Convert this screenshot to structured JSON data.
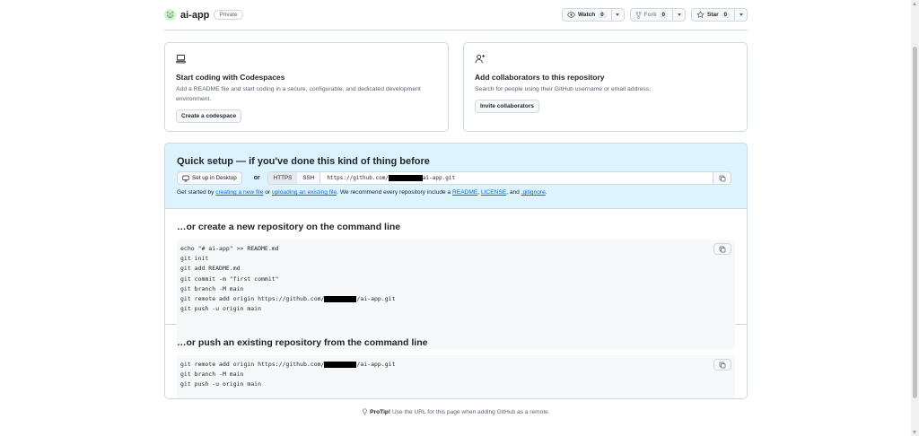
{
  "header": {
    "repo_name": "ai-app",
    "visibility": "Private",
    "watch": {
      "label": "Watch",
      "count": "0"
    },
    "fork": {
      "label": "Fork",
      "count": "0"
    },
    "star": {
      "label": "Star",
      "count": "0"
    }
  },
  "codespaces_card": {
    "title": "Start coding with Codespaces",
    "desc": "Add a README file and start coding in a secure, configurable, and dedicated development environment.",
    "button": "Create a codespace"
  },
  "collab_card": {
    "title": "Add collaborators to this repository",
    "desc": "Search for people using their GitHub username or email address.",
    "button": "Invite collaborators"
  },
  "quick_setup": {
    "title": "Quick setup — if you've done this kind of thing before",
    "desktop_button": "Set up in Desktop",
    "or": "or",
    "https": "HTTPS",
    "ssh": "SSH",
    "url_prefix": "https://github.com/",
    "url_suffix": "ai-app.git",
    "hint": {
      "p1": "Get started by ",
      "link1": "creating a new file",
      "p2": " or ",
      "link2": "uploading an existing file",
      "p3": ". We recommend every repository include a ",
      "link3": "README",
      "p4": ", ",
      "link4": "LICENSE",
      "p5": ", and ",
      "link5": ".gitignore",
      "p6": "."
    }
  },
  "new_repo": {
    "title": "…or create a new repository on the command line",
    "lines": [
      "echo \"# ai-app\" >> README.md",
      "git init",
      "git add README.md",
      "git commit -m \"first commit\"",
      "git branch -M main",
      "git remote add origin https://github.com/",
      "git push -u origin main"
    ],
    "remote_suffix": "/ai-app.git"
  },
  "push_repo": {
    "title": "…or push an existing repository from the command line",
    "remote_prefix": "git remote add origin https://github.com/",
    "remote_suffix": "/ai-app.git",
    "lines": [
      "git branch -M main",
      "git push -u origin main"
    ]
  },
  "protip": {
    "bold": "ProTip!",
    "text": " Use the URL for this page when adding GitHub as a remote."
  }
}
